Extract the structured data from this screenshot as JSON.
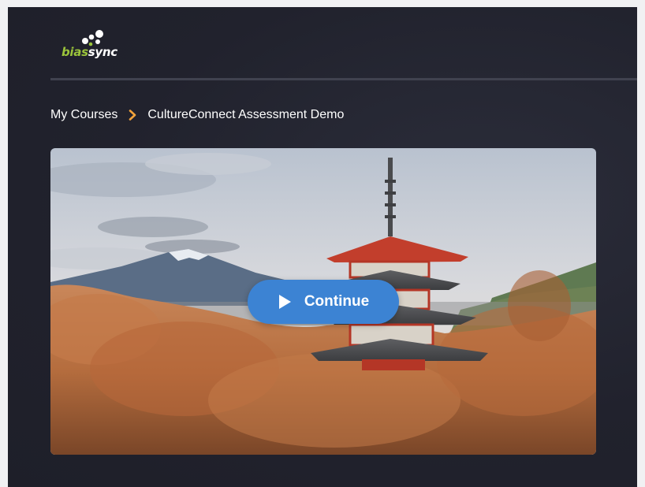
{
  "header": {
    "logo": {
      "text_part1": "bias",
      "text_part2": "sync"
    }
  },
  "breadcrumb": {
    "parent": "My Courses",
    "current": "CultureConnect Assessment Demo",
    "separator_icon": "chevron-right-icon"
  },
  "hero": {
    "image_subject": "pagoda-mountain-autumn-photo",
    "continue_button": {
      "label": "Continue",
      "icon": "play-icon"
    }
  },
  "colors": {
    "background": "#21222d",
    "brand_green": "#9bc43b",
    "accent_orange": "#f2a33b",
    "button_blue": "#3c83d3"
  }
}
